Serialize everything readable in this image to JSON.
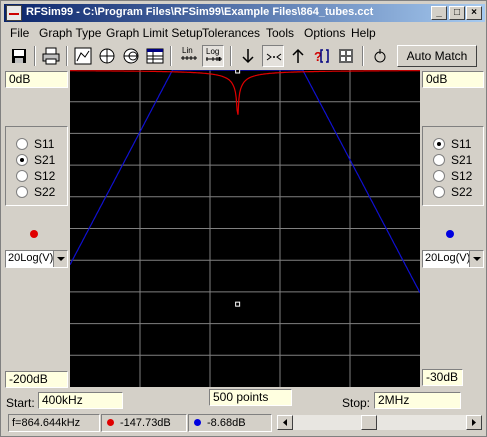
{
  "window": {
    "title": "RFSim99 - C:\\Program Files\\RFSim99\\Example Files\\864_tubes.cct"
  },
  "titlebar_buttons": {
    "minimize": "_",
    "maximize": "□",
    "close": "×"
  },
  "menu": [
    "File",
    "Graph Type",
    "Graph Limit Setup",
    "Tolerances",
    "Tools",
    "Options",
    "Help"
  ],
  "toolbar": {
    "icons": [
      "save-icon",
      "print-icon",
      "rect-graph-icon",
      "polar-icon",
      "smith-chart-icon",
      "table-icon",
      "lin-icon",
      "log-icon",
      "arrow-down-icon",
      "zoom-in-icon",
      "arrow-up-icon",
      "help-icon",
      "component-icon",
      "marker-icon"
    ],
    "lin_label": "Lin",
    "log_label": "Log",
    "auto_match": "Auto Match"
  },
  "left_panel": {
    "top_value": "0dB",
    "bottom_value": "-200dB",
    "scale": "20Log(V)",
    "params": [
      "S11",
      "S21",
      "S12",
      "S22"
    ],
    "selected": "S21",
    "marker_color": "#e00000"
  },
  "right_panel": {
    "top_value": "0dB",
    "bottom_value": "-30dB",
    "scale": "20Log(V)",
    "params": [
      "S11",
      "S21",
      "S12",
      "S22"
    ],
    "selected": "S11",
    "marker_color": "#0000e0"
  },
  "bottom": {
    "start_label": "Start:",
    "start_value": "400kHz",
    "points": "500 points",
    "stop_label": "Stop:",
    "stop_value": "2MHz"
  },
  "status": {
    "freq": "f=864.644kHz",
    "red_value": "-147.73dB",
    "blue_value": "-8.68dB"
  },
  "chart_data": {
    "type": "line",
    "x_range": [
      400,
      2000
    ],
    "x_unit": "kHz",
    "x_scale": "log",
    "grid": true,
    "series": [
      {
        "color": "#e00000",
        "axis": "left",
        "ylim": [
          -200,
          0
        ],
        "notch_x": 864.644,
        "notch_y": -147.73
      },
      {
        "color": "#1010d0",
        "axis": "right",
        "ylim": [
          -30,
          0
        ],
        "notch_x": 864.644,
        "notch_y": -8.68
      }
    ]
  }
}
